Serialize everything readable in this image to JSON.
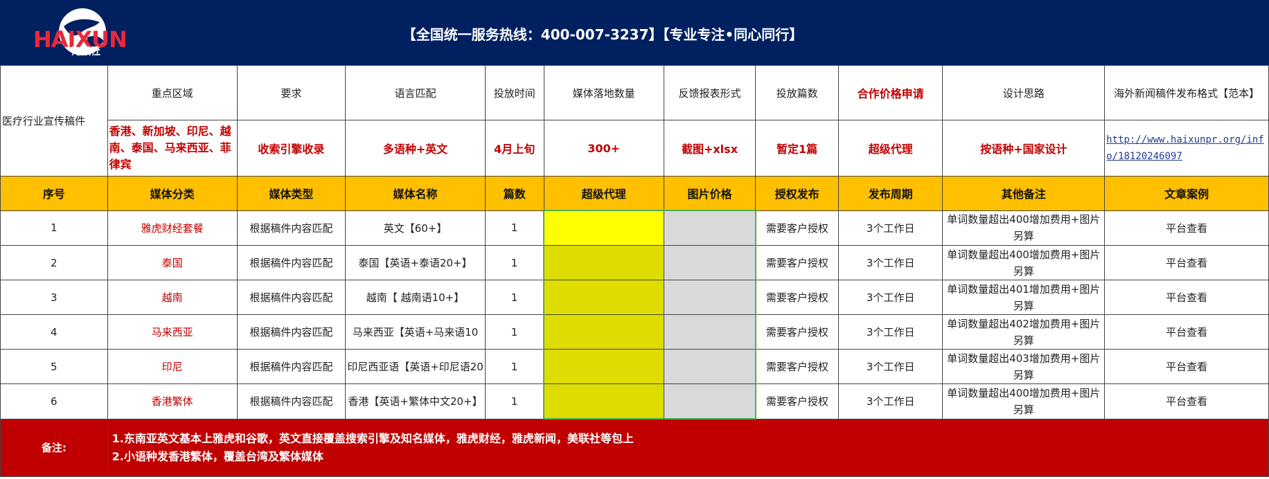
{
  "banner": {
    "logo_text": "HAIXUN",
    "logo_sub": "海讯社",
    "hotline": "【全国统一服务热线：400-007-3237】【专业专注•同心同行】"
  },
  "summary": {
    "project": "医疗行业宣传稿件",
    "headers": [
      "重点区域",
      "要求",
      "语言匹配",
      "投放时间",
      "媒体落地数量",
      "反馈报表形式",
      "投放篇数",
      "合作价格申请",
      "设计思路",
      "海外新闻稿件发布格式【范本】"
    ],
    "values": [
      "香港、新加坡、印尼、越南、泰国、马来西亚、菲律宾",
      "收索引擎收录",
      "多语种+英文",
      "4月上旬",
      "300+",
      "截图+xlsx",
      "暂定1篇",
      "超级代理",
      "按语种+国家设计",
      "http://www.haixunpr.org/info/18120246097"
    ]
  },
  "columns": [
    "序号",
    "媒体分类",
    "媒体类型",
    "媒体名称",
    "篇数",
    "超级代理",
    "图片价格",
    "授权发布",
    "发布周期",
    "其他备注",
    "文章案例"
  ],
  "rows": [
    {
      "no": "1",
      "category": "雅虎财经套餐",
      "type": "根据稿件内容匹配",
      "name": "英文【60+】",
      "count": "1",
      "agent": "",
      "img": "",
      "auth": "需要客户授权",
      "cycle": "3个工作日",
      "note": "单词数量超出400增加费用+图片另算",
      "case": "平台查看"
    },
    {
      "no": "2",
      "category": "泰国",
      "type": "根据稿件内容匹配",
      "name": "泰国【英语+泰语20+】",
      "count": "1",
      "agent": "",
      "img": "",
      "auth": "需要客户授权",
      "cycle": "3个工作日",
      "note": "单词数量超出400增加费用+图片另算",
      "case": "平台查看"
    },
    {
      "no": "3",
      "category": "越南",
      "type": "根据稿件内容匹配",
      "name": "越南【 越南语10+】",
      "count": "1",
      "agent": "",
      "img": "",
      "auth": "需要客户授权",
      "cycle": "3个工作日",
      "note": "单词数量超出401增加费用+图片另算",
      "case": "平台查看"
    },
    {
      "no": "4",
      "category": "马来西亚",
      "type": "根据稿件内容匹配",
      "name": "马来西亚【英语+马来语10",
      "count": "1",
      "agent": "",
      "img": "",
      "auth": "需要客户授权",
      "cycle": "3个工作日",
      "note": "单词数量超出402增加费用+图片另算",
      "case": "平台查看"
    },
    {
      "no": "5",
      "category": "印尼",
      "type": "根据稿件内容匹配",
      "name": "印尼西亚语【英语+印尼语20",
      "count": "1",
      "agent": "",
      "img": "",
      "auth": "需要客户授权",
      "cycle": "3个工作日",
      "note": "单词数量超出403增加费用+图片另算",
      "case": "平台查看"
    },
    {
      "no": "6",
      "category": "香港繁体",
      "type": "根据稿件内容匹配",
      "name": "香港【英语+繁体中文20+】",
      "count": "1",
      "agent": "",
      "img": "",
      "auth": "需要客户授权",
      "cycle": "3个工作日",
      "note": "单词数量超出400增加费用+图片另算",
      "case": "平台查看"
    }
  ],
  "notes": {
    "label": "备注:",
    "line1": "1.东南亚英文基本上雅虎和谷歌，英文直接覆盖搜索引擎及知名媒体，雅虎财经，雅虎新闻，美联社等包上",
    "line2": "2.小语种发香港繁体，覆盖台湾及繁体媒体"
  },
  "colors": {
    "banner": "#002060",
    "header_row": "#ffc000",
    "accent_red": "#c00000",
    "agent_fill": "#dedc00",
    "agent_selected": "#ffff00",
    "image_fill": "#d9d9d9"
  }
}
